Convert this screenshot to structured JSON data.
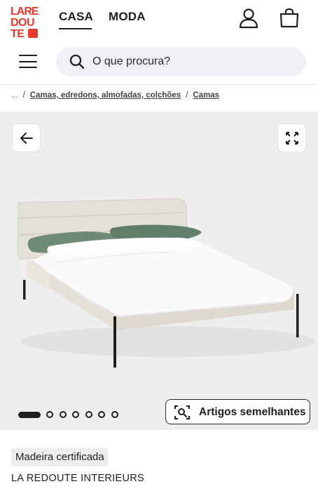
{
  "header": {
    "logo_lines": [
      "LARE",
      "DOU",
      "TE"
    ],
    "logo_color": "#e8392d",
    "tabs": [
      {
        "label": "CASA",
        "active": true
      },
      {
        "label": "MODA",
        "active": false
      }
    ],
    "account_icon": "user-icon",
    "bag_icon": "shopping-bag-icon"
  },
  "search": {
    "menu_icon": "hamburger-menu-icon",
    "search_icon": "search-icon",
    "placeholder": "O que procura?"
  },
  "breadcrumb": {
    "ellipsis": "...",
    "separator": "/",
    "items": [
      "Camas, edredons, almofadas, colchões",
      "Camas"
    ]
  },
  "gallery": {
    "back_icon": "arrow-left-icon",
    "expand_icon": "expand-icon",
    "image_subject": "upholstered bed with green pillows",
    "dot_count": 7,
    "active_dot": 0,
    "similar_button_icon": "visual-search-icon",
    "similar_button_label": "Artigos semelhantes"
  },
  "product": {
    "badge": "Madeira certificada",
    "brand": "LA REDOUTE INTERIEURS"
  }
}
